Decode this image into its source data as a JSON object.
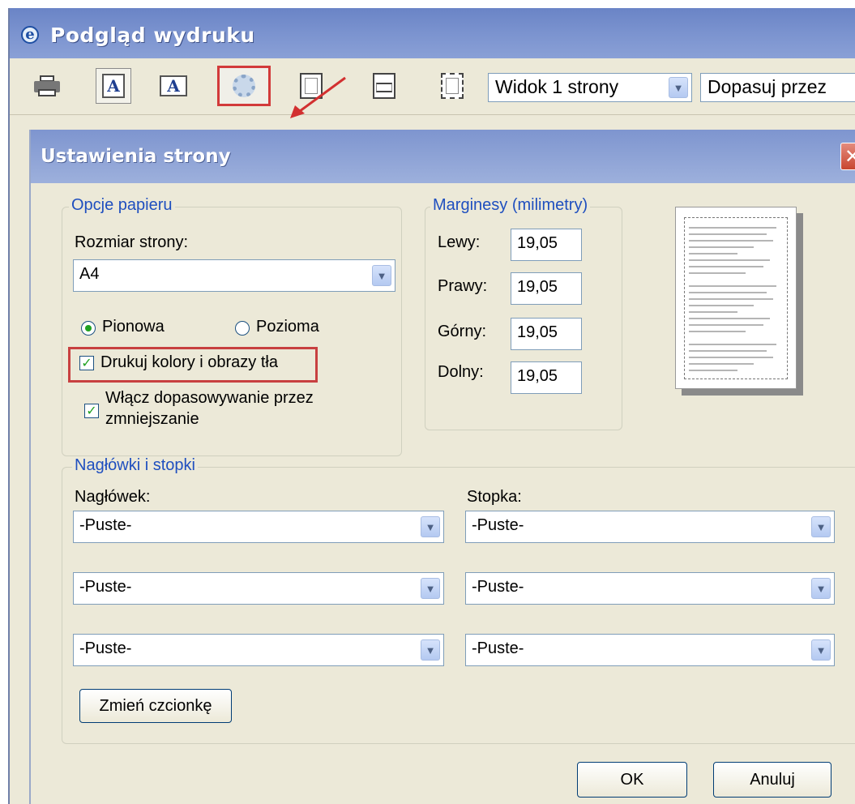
{
  "window": {
    "title": "Podgląd wydruku",
    "icon": "ie-icon"
  },
  "toolbar": {
    "view_select": "Widok 1 strony",
    "fit_select": "Dopasuj przez"
  },
  "dialog": {
    "title": "Ustawienia strony",
    "paper": {
      "group_label": "Opcje papieru",
      "size_label": "Rozmiar strony:",
      "size_value": "A4",
      "portrait": "Pionowa",
      "landscape": "Pozioma",
      "orientation_selected": "Pionowa",
      "print_bg": "Drukuj kolory i obrazy tła",
      "print_bg_checked": true,
      "shrink_line1": "Włącz dopasowywanie przez",
      "shrink_line2": "zmniejszanie",
      "shrink_checked": true
    },
    "margins": {
      "group_label": "Marginesy (milimetry)",
      "left_label": "Lewy:",
      "left_value": "19,05",
      "right_label": "Prawy:",
      "right_value": "19,05",
      "top_label": "Górny:",
      "top_value": "19,05",
      "bottom_label": "Dolny:",
      "bottom_value": "19,05"
    },
    "headers": {
      "group_label": "Nagłówki i stopki",
      "header_label": "Nagłówek:",
      "footer_label": "Stopka:",
      "header_values": [
        "-Puste-",
        "-Puste-",
        "-Puste-"
      ],
      "footer_values": [
        "-Puste-",
        "-Puste-",
        "-Puste-"
      ],
      "font_button": "Zmień czcionkę"
    },
    "ok": "OK",
    "cancel": "Anuluj"
  },
  "colors": {
    "highlight": "#c84040",
    "group_label": "#1f4fbf",
    "dialog_bg": "#ece9d8"
  }
}
